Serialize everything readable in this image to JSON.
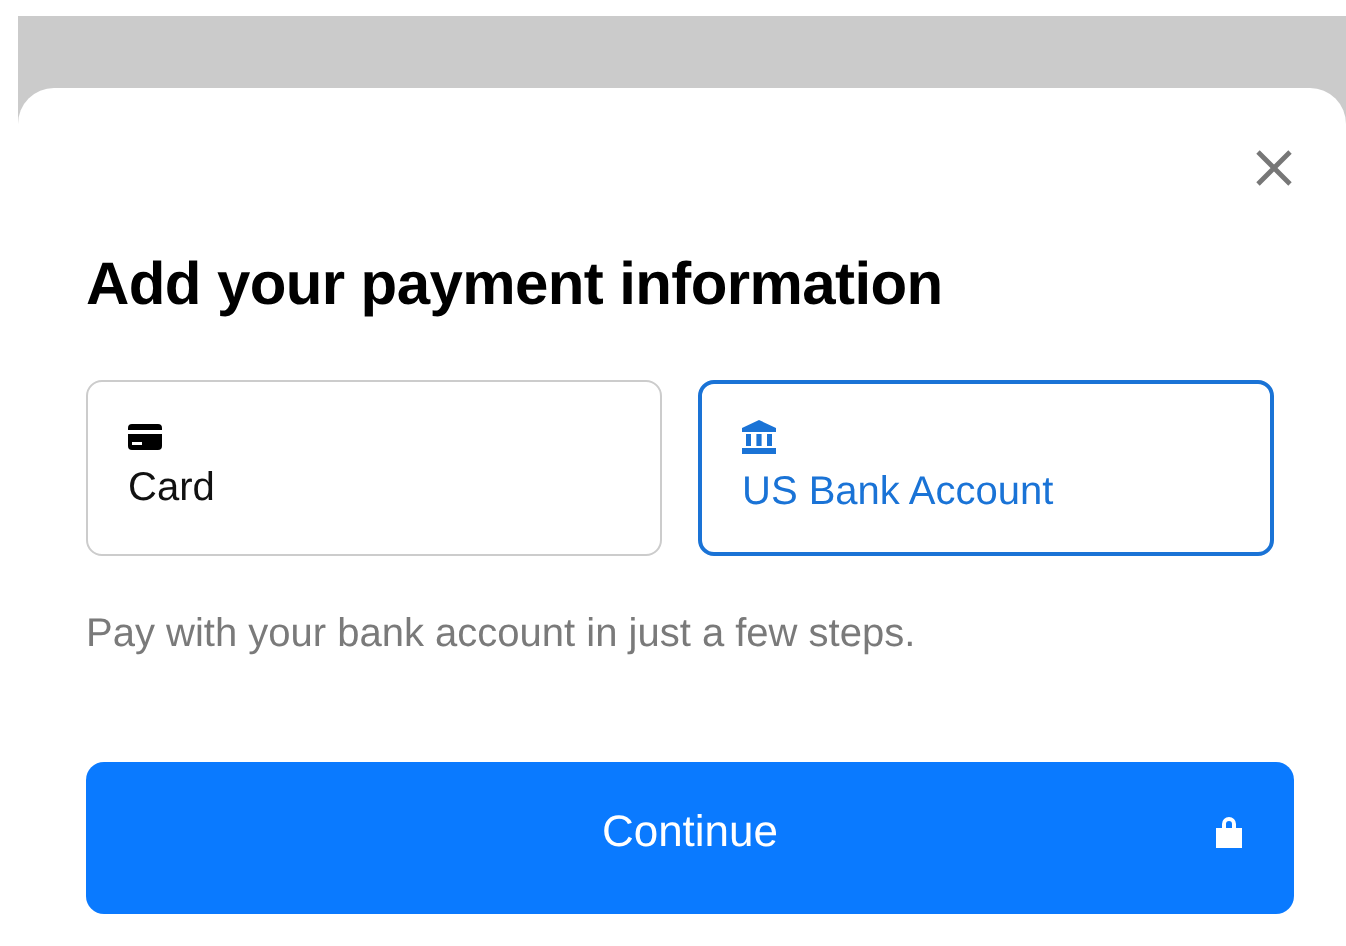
{
  "title": "Add your payment information",
  "methods": [
    {
      "label": "Card",
      "kind": "card",
      "selected": false
    },
    {
      "label": "US Bank Account",
      "kind": "bank",
      "selected": true
    }
  ],
  "description": "Pay with your bank account in just a few steps.",
  "button": {
    "label": "Continue"
  }
}
